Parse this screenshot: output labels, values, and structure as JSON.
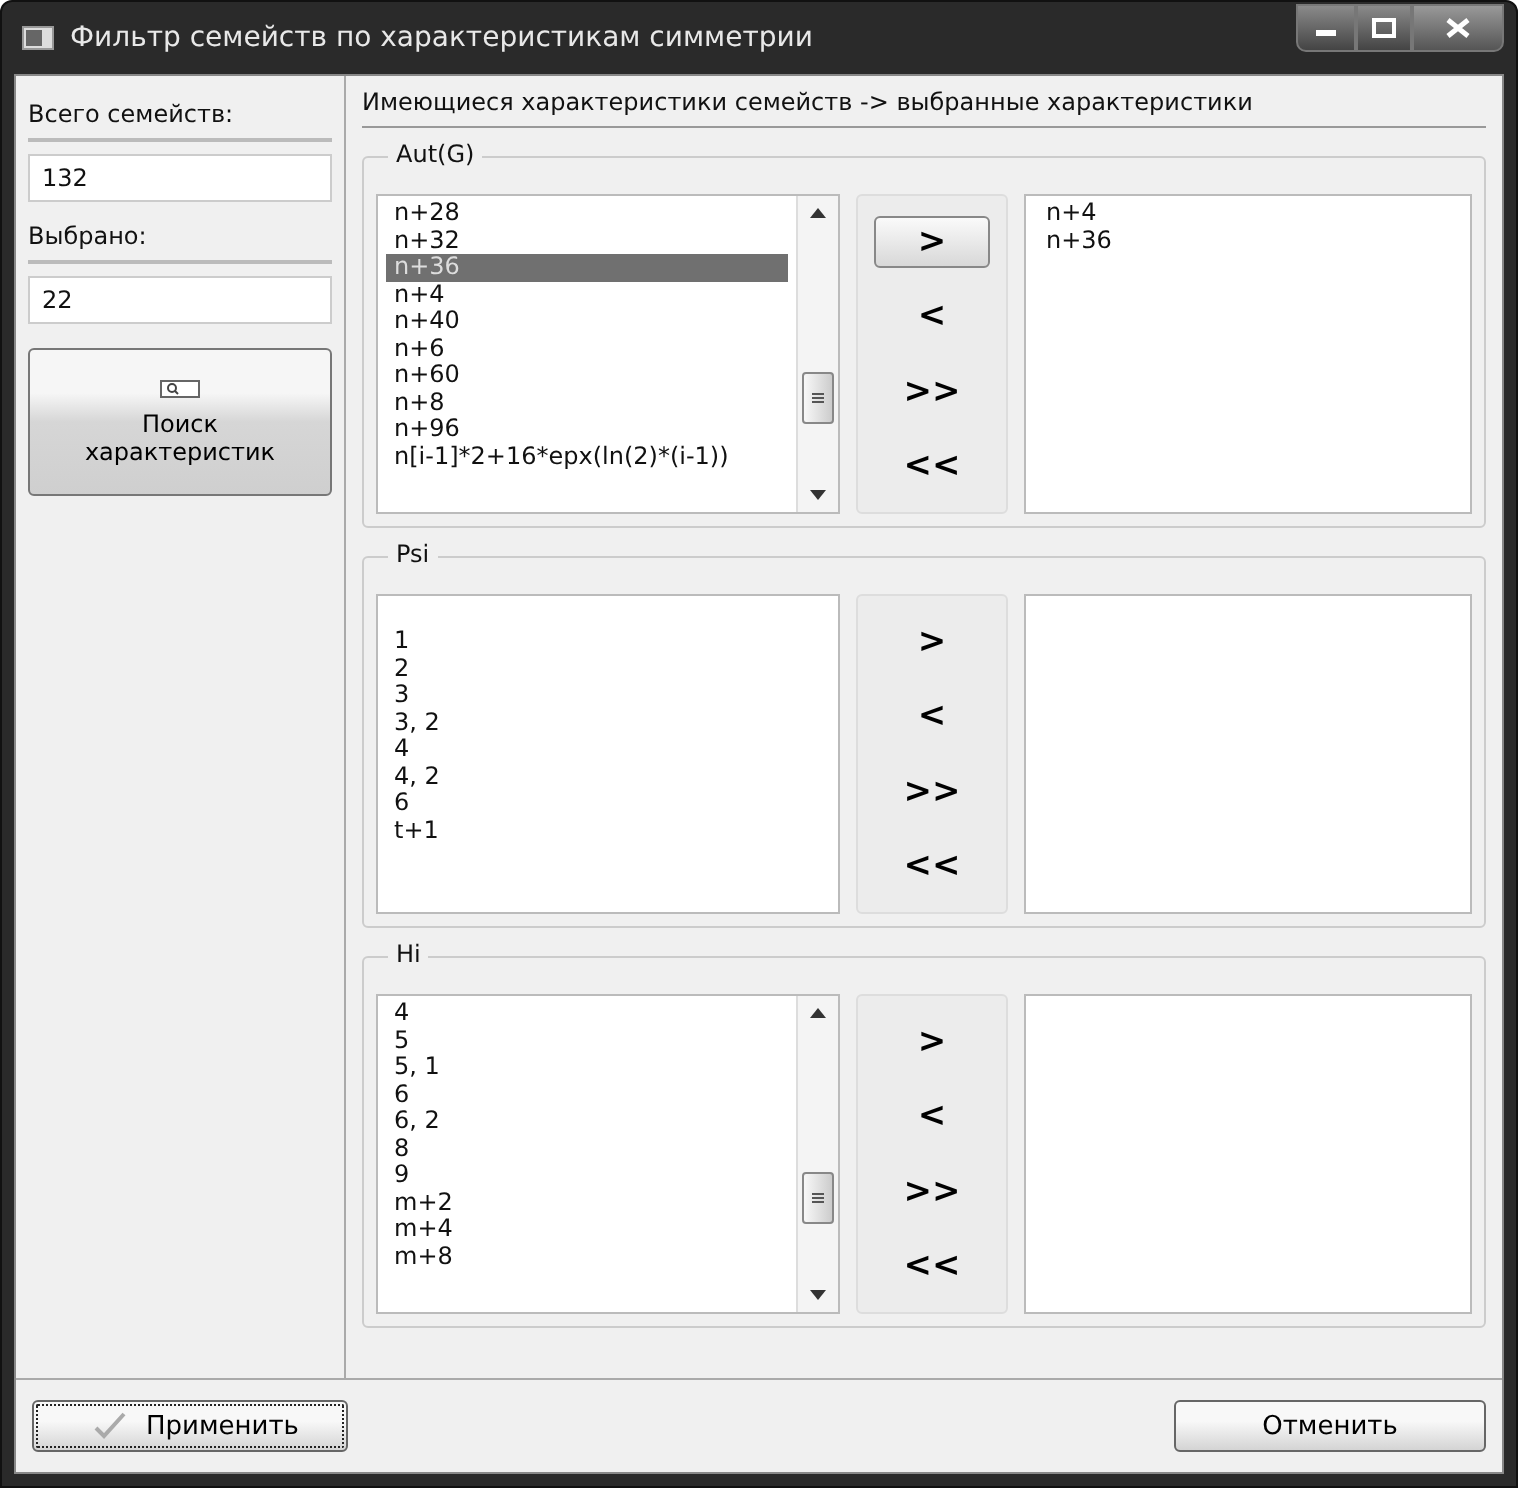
{
  "window": {
    "title": "Фильтр семейств по характеристикам симметрии"
  },
  "sidebar": {
    "total_label": "Всего семейств:",
    "total_value": "132",
    "selected_label": "Выбрано:",
    "selected_value": "22",
    "search_button": "Поиск характеристик"
  },
  "header": "Имеющиеся характеристики семейств -> выбранные характеристики",
  "groups": [
    {
      "title": "Aut(G)",
      "scrollable": true,
      "available": [
        {
          "text": "n+28",
          "selected": false
        },
        {
          "text": "n+32",
          "selected": false
        },
        {
          "text": "n+36",
          "selected": true
        },
        {
          "text": "n+4",
          "selected": false
        },
        {
          "text": "n+40",
          "selected": false
        },
        {
          "text": "n+6",
          "selected": false
        },
        {
          "text": "n+60",
          "selected": false
        },
        {
          "text": "n+8",
          "selected": false
        },
        {
          "text": "n+96",
          "selected": false
        },
        {
          "text": "n[i-1]*2+16*epx(ln(2)*(i-1))",
          "selected": false
        }
      ],
      "buttons": [
        {
          "label": ">",
          "focused": true
        },
        {
          "label": "<",
          "focused": false
        },
        {
          "label": ">>",
          "focused": false
        },
        {
          "label": "<<",
          "focused": false
        }
      ],
      "chosen": [
        {
          "text": "n+4",
          "selected": false
        },
        {
          "text": "n+36",
          "selected": false
        }
      ]
    },
    {
      "title": "Psi",
      "scrollable": false,
      "available": [
        {
          "text": "1",
          "selected": false
        },
        {
          "text": "2",
          "selected": false
        },
        {
          "text": "3",
          "selected": false
        },
        {
          "text": "3, 2",
          "selected": false
        },
        {
          "text": "4",
          "selected": false
        },
        {
          "text": "4, 2",
          "selected": false
        },
        {
          "text": "6",
          "selected": false
        },
        {
          "text": "t+1",
          "selected": false
        }
      ],
      "buttons": [
        {
          "label": ">",
          "focused": false
        },
        {
          "label": "<",
          "focused": false
        },
        {
          "label": ">>",
          "focused": false
        },
        {
          "label": "<<",
          "focused": false
        }
      ]
    },
    {
      "title": "Hi",
      "scrollable": true,
      "available": [
        {
          "text": "4",
          "selected": false
        },
        {
          "text": "5",
          "selected": false
        },
        {
          "text": "5, 1",
          "selected": false
        },
        {
          "text": "6",
          "selected": false
        },
        {
          "text": "6, 2",
          "selected": false
        },
        {
          "text": "8",
          "selected": false
        },
        {
          "text": "9",
          "selected": false
        },
        {
          "text": "m+2",
          "selected": false
        },
        {
          "text": "m+4",
          "selected": false
        },
        {
          "text": "m+8",
          "selected": false
        }
      ],
      "buttons": [
        {
          "label": ">",
          "focused": false
        },
        {
          "label": "<",
          "focused": false
        },
        {
          "label": ">>",
          "focused": false
        },
        {
          "label": "<<",
          "focused": false
        }
      ]
    }
  ],
  "footer": {
    "apply": {
      "label": "Применить",
      "focused": true
    },
    "cancel": {
      "label": "Отменить",
      "focused": false
    }
  }
}
